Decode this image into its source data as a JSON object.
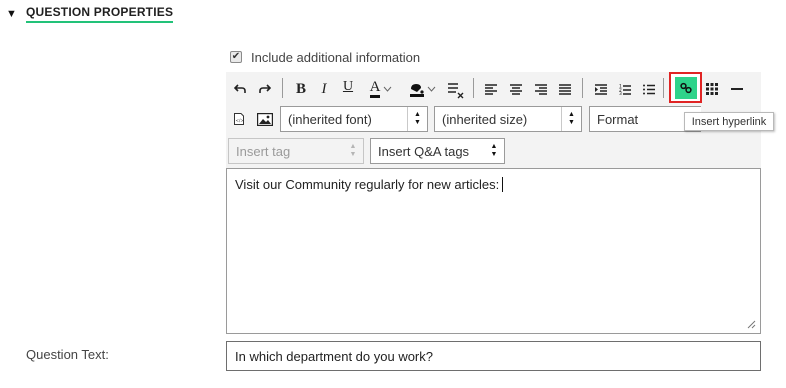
{
  "section": {
    "toggle_glyph": "▼",
    "title": "QUESTION PROPERTIES",
    "underline_color": "#22c279"
  },
  "include_info": {
    "label": "Include additional information",
    "checked": true
  },
  "toolbar": {
    "undo_icon": "undo-icon",
    "redo_icon": "redo-icon",
    "bold": "B",
    "italic": "I",
    "underline": "U",
    "font_color_letter": "A",
    "font_dropdown": {
      "value": "(inherited font)"
    },
    "size_dropdown": {
      "value": "(inherited size)"
    },
    "format_dropdown": {
      "value": "Format"
    },
    "insert_tag": {
      "value": "Insert tag"
    },
    "insert_qa_tags": {
      "value": "Insert Q&A tags"
    },
    "link_button_color": "#2ed38a",
    "highlight_color": "#e02424"
  },
  "tooltip": {
    "text": "Insert hyperlink"
  },
  "editor": {
    "content": "Visit our Community regularly for new articles:"
  },
  "question_text": {
    "label": "Question Text:",
    "value": "In which department do you work?"
  }
}
